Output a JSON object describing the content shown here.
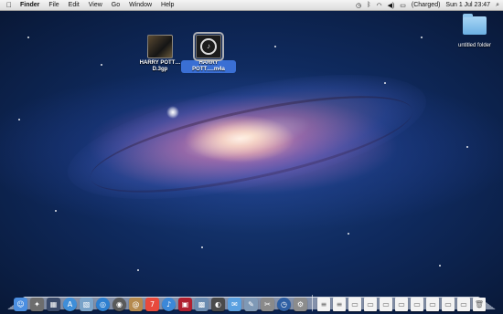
{
  "menubar": {
    "apple_icon": "apple-icon",
    "items": [
      "Finder",
      "File",
      "Edit",
      "View",
      "Go",
      "Window",
      "Help"
    ],
    "battery_status": "(Charged)",
    "clock": "Sun 1 Jul 23:47"
  },
  "desktop": {
    "icons": [
      {
        "label": "HARRY POTT…D.3gp",
        "kind": "video-file",
        "selected": false
      },
      {
        "label": "HARRY POTT….m4a",
        "kind": "audio-file",
        "selected": true
      },
      {
        "label": "untitled folder",
        "kind": "folder",
        "selected": false
      }
    ]
  },
  "dock": {
    "apps": [
      {
        "name": "finder-icon",
        "color": "#4b8ee0",
        "glyph": "☺"
      },
      {
        "name": "launchpad-icon",
        "color": "#6d6d6d",
        "glyph": "✦"
      },
      {
        "name": "mission-control-icon",
        "color": "#3a4a6a",
        "glyph": "▦"
      },
      {
        "name": "app-store-icon",
        "color": "#3f8ed8",
        "glyph": "A"
      },
      {
        "name": "photo-icon",
        "color": "#7aa3c9",
        "glyph": "▧"
      },
      {
        "name": "safari-icon",
        "color": "#2d7fd0",
        "glyph": "◎"
      },
      {
        "name": "facetime-icon",
        "color": "#5a5a5a",
        "glyph": "◉"
      },
      {
        "name": "contacts-icon",
        "color": "#b58a4e",
        "glyph": "@"
      },
      {
        "name": "calendar-icon",
        "color": "#e84a3c",
        "glyph": "7"
      },
      {
        "name": "itunes-icon",
        "color": "#3c88d8",
        "glyph": "♪"
      },
      {
        "name": "photo-booth-icon",
        "color": "#b02030",
        "glyph": "▣"
      },
      {
        "name": "iphoto-icon",
        "color": "#6b8bb0",
        "glyph": "▩"
      },
      {
        "name": "dashboard-icon",
        "color": "#4a4a4a",
        "glyph": "◐"
      },
      {
        "name": "messages-icon",
        "color": "#5aa0e0",
        "glyph": "✉"
      },
      {
        "name": "preview-icon",
        "color": "#7f99b6",
        "glyph": "✎"
      },
      {
        "name": "automator-icon",
        "color": "#8a8a8a",
        "glyph": "✂"
      },
      {
        "name": "time-machine-icon",
        "color": "#2e5fa3",
        "glyph": "◷"
      },
      {
        "name": "system-preferences-icon",
        "color": "#8c8c8c",
        "glyph": "⚙"
      }
    ],
    "docs": [
      {
        "name": "document-icon",
        "glyph": "≡"
      },
      {
        "name": "document-icon",
        "glyph": "≡"
      },
      {
        "name": "screenshot-icon",
        "glyph": "▭"
      },
      {
        "name": "screenshot-icon",
        "glyph": "▭"
      },
      {
        "name": "screenshot-icon",
        "glyph": "▭"
      },
      {
        "name": "screenshot-icon",
        "glyph": "▭"
      },
      {
        "name": "screenshot-icon",
        "glyph": "▭"
      },
      {
        "name": "screenshot-icon",
        "glyph": "▭"
      },
      {
        "name": "screenshot-icon",
        "glyph": "▭"
      },
      {
        "name": "screenshot-icon",
        "glyph": "▭"
      },
      {
        "name": "trash-icon",
        "glyph": "🗑"
      }
    ]
  }
}
